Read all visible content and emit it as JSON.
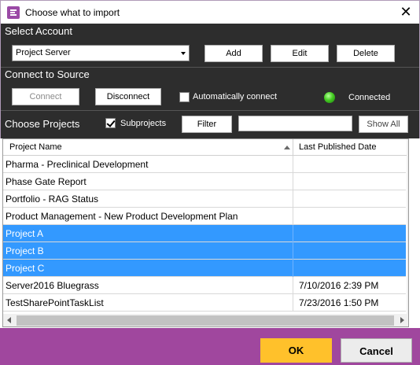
{
  "window": {
    "title": "Choose what to import",
    "close_glyph": "✕",
    "app_icon": "import-app-icon"
  },
  "account": {
    "section_label": "Select Account",
    "selected": "Project Server",
    "add_label": "Add",
    "edit_label": "Edit",
    "delete_label": "Delete"
  },
  "source": {
    "section_label": "Connect to Source",
    "connect_label": "Connect",
    "disconnect_label": "Disconnect",
    "auto_connect_label": "Automatically connect",
    "auto_connect_checked": false,
    "status_label": "Connected",
    "status_color": "#44cc22"
  },
  "projects": {
    "section_label": "Choose Projects",
    "subprojects_label": "Subprojects",
    "subprojects_checked": true,
    "filter_label": "Filter",
    "filter_value": "",
    "show_all_label": "Show All"
  },
  "grid": {
    "columns": [
      "Project Name",
      "Last Published Date"
    ],
    "sort_column": "Project Name",
    "sort_direction": "ascending",
    "rows": [
      {
        "name": "Pharma - Preclinical Development",
        "date": "",
        "selected": false
      },
      {
        "name": "Phase Gate Report",
        "date": "",
        "selected": false
      },
      {
        "name": "Portfolio - RAG Status",
        "date": "",
        "selected": false
      },
      {
        "name": "Product Management - New Product Development Plan",
        "date": "",
        "selected": false
      },
      {
        "name": "Project A",
        "date": "",
        "selected": true
      },
      {
        "name": "Project B",
        "date": "",
        "selected": true
      },
      {
        "name": "Project C",
        "date": "",
        "selected": true
      },
      {
        "name": "Server2016 Bluegrass",
        "date": "7/10/2016 2:39 PM",
        "selected": false
      },
      {
        "name": "TestSharePointTaskList",
        "date": "7/23/2016 1:50 PM",
        "selected": false
      }
    ]
  },
  "footer": {
    "ok_label": "OK",
    "cancel_label": "Cancel",
    "accent": "#a0479e",
    "ok_color": "#ffc12b"
  }
}
